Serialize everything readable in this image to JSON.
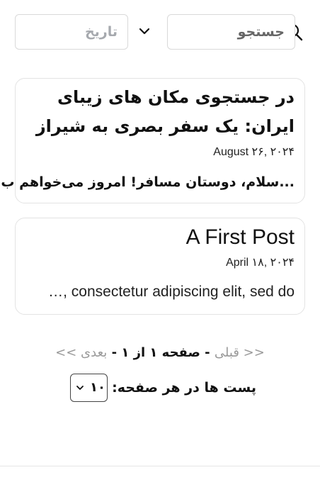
{
  "search": {
    "placeholder": "جستجو"
  },
  "date_filter": {
    "placeholder": "تاریخ"
  },
  "posts": [
    {
      "title_line1": "در جستجوی مکان های زیبای",
      "title_line2": "ایران: یک سفر بصری به شیراز",
      "date": "August ۲۶, ۲۰۲۴",
      "excerpt": "سلام، دوستان مسافر! امروز می‌خواهم ب..."
    },
    {
      "title_line1": "A First Post",
      "date": "April ۱۸, ۲۰۲۴",
      "excerpt": "…, consectetur adipiscing elit, sed do"
    }
  ],
  "pagination": {
    "prev": "<< قبلی",
    "separator1": " - ",
    "page_info": "صفحه ۱ از ۱",
    "separator2": " - ",
    "next": "بعدی >>"
  },
  "per_page": {
    "label": "پست ها در هر صفحه:",
    "value": "۱۰"
  }
}
